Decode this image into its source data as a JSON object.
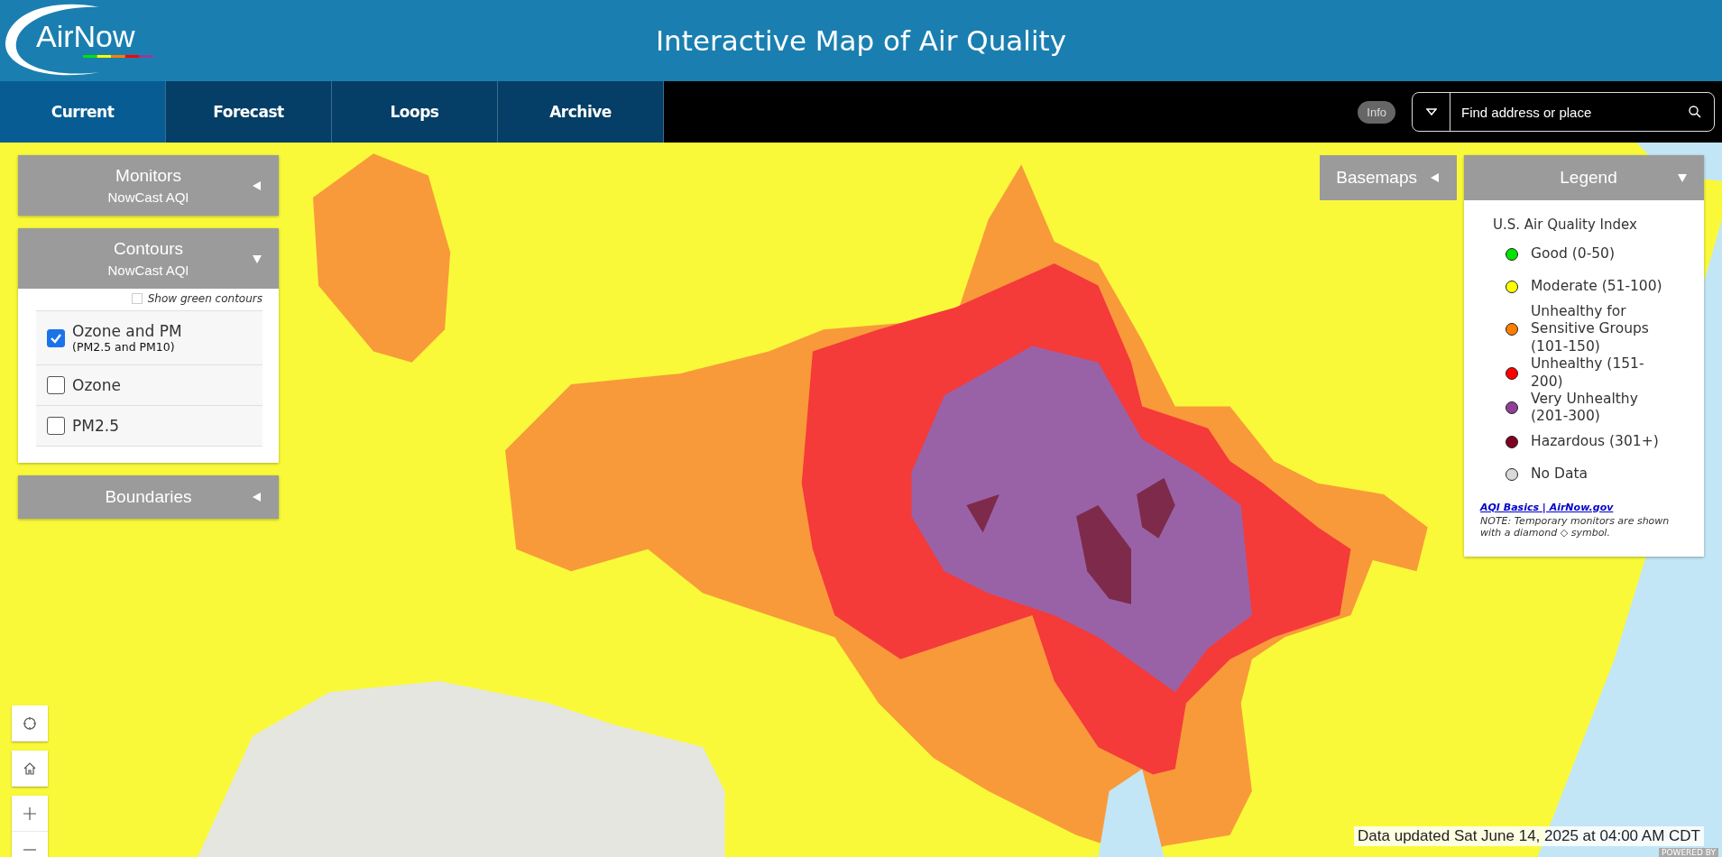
{
  "header": {
    "logo_text": "AirNow",
    "title": "Interactive Map of Air Quality"
  },
  "tabs": [
    {
      "label": "Current",
      "selected": true
    },
    {
      "label": "Forecast",
      "selected": false
    },
    {
      "label": "Loops",
      "selected": false
    },
    {
      "label": "Archive",
      "selected": false
    }
  ],
  "info_button": "Info",
  "search": {
    "placeholder": "Find address or place"
  },
  "panels": [
    {
      "title": "Monitors",
      "subtitle": "NowCast AQI",
      "expanded": false
    },
    {
      "title": "Contours",
      "subtitle": "NowCast AQI",
      "expanded": true,
      "show_green": {
        "label": "Show green contours",
        "checked": false
      },
      "layers": [
        {
          "label": "Ozone and PM",
          "detail": "(PM2.5 and PM10)",
          "checked": true
        },
        {
          "label": "Ozone",
          "checked": false
        },
        {
          "label": "PM2.5",
          "checked": false
        }
      ]
    },
    {
      "title": "Boundaries",
      "expanded": false
    }
  ],
  "basemaps": {
    "title": "Basemaps",
    "expanded": false
  },
  "legend": {
    "title": "Legend",
    "expanded": true,
    "heading": "U.S. Air Quality Index",
    "items": [
      {
        "label": "Good (0-50)",
        "color": "#00e400"
      },
      {
        "label": "Moderate (51-100)",
        "color": "#ffff00"
      },
      {
        "label": "Unhealthy for Sensitive Groups (101-150)",
        "color": "#ff7e00"
      },
      {
        "label": "Unhealthy (151-200)",
        "color": "#ff0000"
      },
      {
        "label": "Very Unhealthy (201-300)",
        "color": "#8f3f97"
      },
      {
        "label": "Hazardous (301+)",
        "color": "#7e0023"
      },
      {
        "label": "No Data",
        "color": "#d9d9d9"
      }
    ],
    "link": "AQI Basics | AirNow.gov",
    "note": "NOTE: Temporary monitors are shown with a diamond ◇ symbol."
  },
  "data_updated": "Data updated Sat June 14, 2025 at 04:00 AM CDT",
  "attribution": "POWERED BY"
}
